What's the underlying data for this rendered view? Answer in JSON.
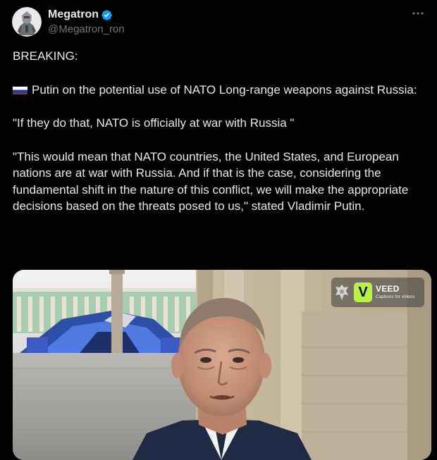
{
  "author": {
    "display_name": "Megatron",
    "handle": "@Megatron_ron",
    "verified": true,
    "avatar_icon": "robot-avatar-icon"
  },
  "menu": {
    "more_icon": "more-horizontal-icon"
  },
  "tweet": {
    "line1": "BREAKING:",
    "flag_icon": "russia-flag-icon",
    "line2": "Putin on the potential use of NATO Long-range weapons against Russia:",
    "line3": "\"If they do that, NATO is officially at war with Russia \"",
    "line4": "\"This would mean that NATO countries, the United States, and European nations are at war with Russia. And if that is the case, considering the fundamental shift in the nature of this conflict, we will make the appropriate decisions based on the threats posed  to us,\" stated Vladimir Putin."
  },
  "media": {
    "watermark_brand": "VEED",
    "watermark_tagline": "Captions for videos",
    "watermark_mark": "V"
  },
  "colors": {
    "background": "#000000",
    "text": "#e7e9ea",
    "secondary": "#71767b",
    "verified": "#1d9bf0",
    "veed_green": "#b6f24a"
  }
}
